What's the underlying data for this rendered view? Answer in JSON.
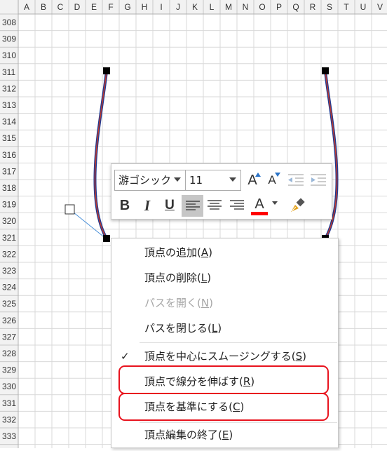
{
  "sheet": {
    "columns": [
      "A",
      "B",
      "C",
      "D",
      "E",
      "F",
      "G",
      "H",
      "I",
      "J",
      "K",
      "L",
      "M",
      "N",
      "O",
      "P",
      "Q",
      "R",
      "S",
      "T",
      "U",
      "V"
    ],
    "rows": [
      "308",
      "309",
      "310",
      "311",
      "312",
      "313",
      "314",
      "315",
      "316",
      "317",
      "318",
      "319",
      "320",
      "321",
      "322",
      "323",
      "324",
      "325",
      "326",
      "327",
      "328",
      "329",
      "330",
      "331",
      "332",
      "333"
    ]
  },
  "toolbar": {
    "font_name": "游ゴシック",
    "font_size": "11",
    "grow_font_label": "A",
    "shrink_font_label": "A",
    "bold_label": "B",
    "italic_label": "I",
    "underline_label": "U",
    "font_color_label": "A",
    "font_color": "#ff0000",
    "icons": [
      "decrease-indent-icon",
      "increase-indent-icon",
      "align-left-icon",
      "align-center-icon",
      "align-right-icon",
      "format-painter-icon"
    ]
  },
  "menu": {
    "items": [
      {
        "label": "頂点の追加(",
        "hotkey": "A",
        "close": ")",
        "enabled": true,
        "checked": false
      },
      {
        "label": "頂点の削除(",
        "hotkey": "L",
        "close": ")",
        "enabled": true,
        "checked": false
      },
      {
        "label": "パスを開く(",
        "hotkey": "N",
        "close": ")",
        "enabled": false,
        "checked": false
      },
      {
        "label": "パスを閉じる(",
        "hotkey": "L",
        "close": ")",
        "enabled": true,
        "checked": false
      },
      {
        "label": "頂点を中心にスムージングする(",
        "hotkey": "S",
        "close": ")",
        "enabled": true,
        "checked": true
      },
      {
        "label": "頂点で線分を伸ばす(",
        "hotkey": "R",
        "close": ")",
        "enabled": true,
        "checked": false
      },
      {
        "label": "頂点を基準にする(",
        "hotkey": "C",
        "close": ")",
        "enabled": true,
        "checked": false
      },
      {
        "label": "頂点編集の終了(",
        "hotkey": "E",
        "close": ")",
        "enabled": true,
        "checked": false
      }
    ]
  },
  "colors": {
    "highlight": "#e8131e",
    "curve_outer": "#1f3a93",
    "curve_inner": "#c0392b",
    "grid": "#d4d4d4",
    "header_bg": "#f2f2f2"
  }
}
